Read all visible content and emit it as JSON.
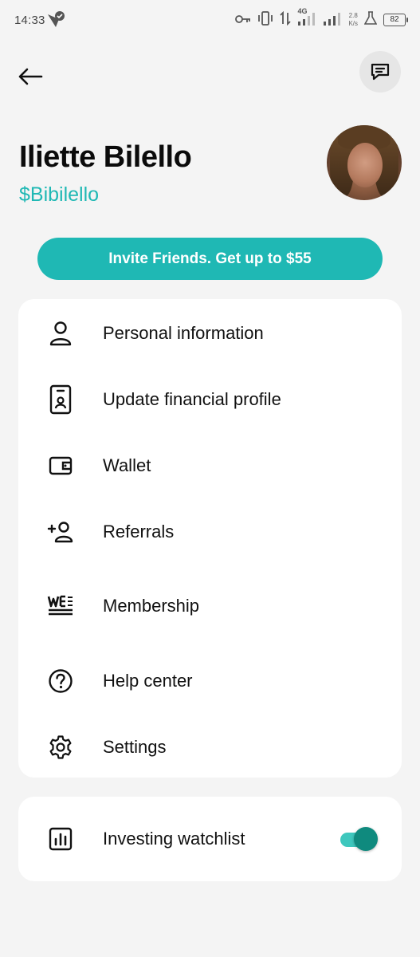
{
  "status_bar": {
    "time": "14:33",
    "network_type": "4G",
    "net_speed_value": "2.8",
    "net_speed_unit": "K/s",
    "battery": "82"
  },
  "profile": {
    "name": "Iliette Bilello",
    "handle": "$Bibilello"
  },
  "invite": {
    "label": "Invite Friends. Get up to $55"
  },
  "menu": {
    "items": [
      {
        "label": "Personal information",
        "icon": "person-icon"
      },
      {
        "label": "Update financial profile",
        "icon": "id-card-icon"
      },
      {
        "label": "Wallet",
        "icon": "wallet-icon"
      },
      {
        "label": "Referrals",
        "icon": "add-person-icon"
      },
      {
        "label": "Membership",
        "icon": "we-logo-icon"
      },
      {
        "label": "Help center",
        "icon": "help-icon"
      },
      {
        "label": "Settings",
        "icon": "gear-icon"
      }
    ]
  },
  "watchlist": {
    "label": "Investing watchlist",
    "icon": "bar-chart-icon",
    "toggle_on": true
  },
  "colors": {
    "accent": "#1fb8b4",
    "toggle_track": "#3ec7bd",
    "toggle_thumb": "#0f8a7e",
    "background": "#f4f4f4",
    "card": "#ffffff"
  }
}
